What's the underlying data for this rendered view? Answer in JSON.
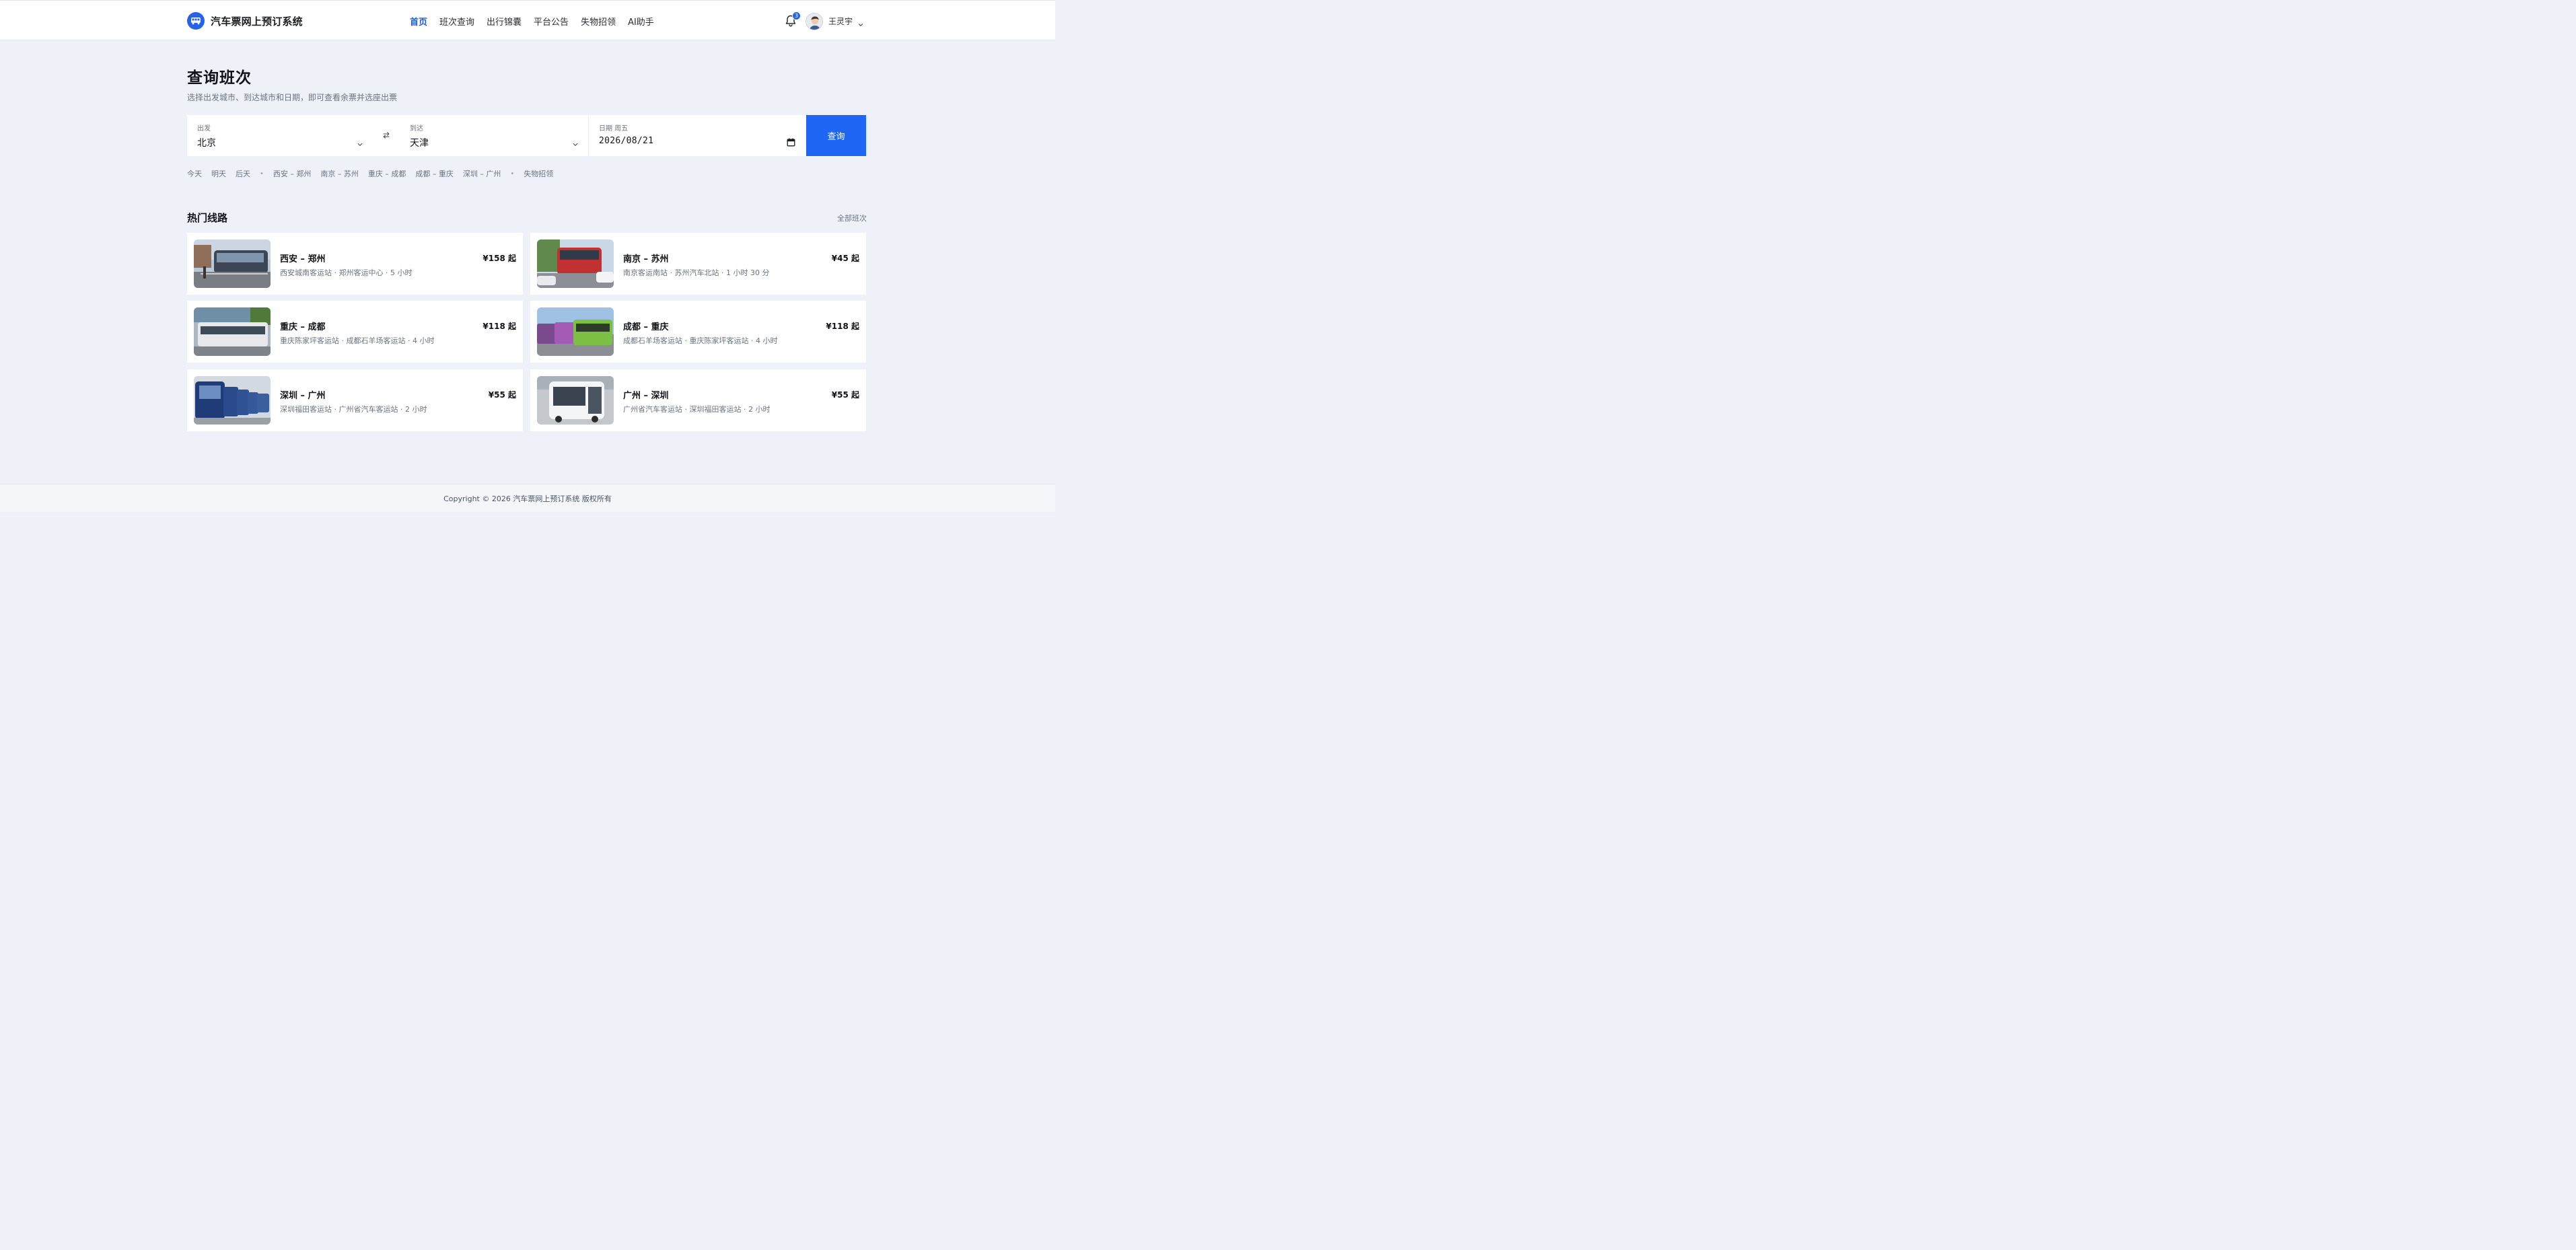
{
  "header": {
    "brand_title": "汽车票网上预订系统",
    "nav": [
      {
        "label": "首页",
        "active": true
      },
      {
        "label": "班次查询"
      },
      {
        "label": "出行锦囊"
      },
      {
        "label": "平台公告"
      },
      {
        "label": "失物招领"
      },
      {
        "label": "AI助手"
      }
    ],
    "notification_count": "3",
    "user_name": "王灵宇"
  },
  "page": {
    "title": "查询班次",
    "subtitle": "选择出发城市、到达城市和日期，即可查看余票并选座出票"
  },
  "search": {
    "from_label": "出发",
    "from_value": "北京",
    "to_label": "到达",
    "to_value": "天津",
    "date_label": "日期 周五",
    "date_value": "2026/08/21",
    "submit_label": "查询"
  },
  "quick_links": {
    "dates": [
      "今天",
      "明天",
      "后天"
    ],
    "routes": [
      "西安 – 郑州",
      "南京 – 苏州",
      "重庆 – 成都",
      "成都 – 重庆",
      "深圳 – 广州"
    ],
    "extra": [
      "失物招领"
    ]
  },
  "hot_routes": {
    "title": "热门线路",
    "all_link": "全部班次",
    "cards": [
      {
        "route": "西安 – 郑州",
        "meta": "西安城南客运站 · 郑州客运中心 · 5 小时",
        "price": "¥158 起"
      },
      {
        "route": "南京 – 苏州",
        "meta": "南京客运南站 · 苏州汽车北站 · 1 小时 30 分",
        "price": "¥45 起"
      },
      {
        "route": "重庆 – 成都",
        "meta": "重庆陈家坪客运站 · 成都石羊场客运站 · 4 小时",
        "price": "¥118 起"
      },
      {
        "route": "成都 – 重庆",
        "meta": "成都石羊场客运站 · 重庆陈家坪客运站 · 4 小时",
        "price": "¥118 起"
      },
      {
        "route": "深圳 – 广州",
        "meta": "深圳福田客运站 · 广州省汽车客运站 · 2 小时",
        "price": "¥55 起"
      },
      {
        "route": "广州 – 深圳",
        "meta": "广州省汽车客运站 · 深圳福田客运站 · 2 小时",
        "price": "¥55 起"
      }
    ]
  },
  "footer": {
    "copyright": "Copyright © 2026 汽车票网上预订系统 版权所有"
  },
  "colors": {
    "accent": "#1f66f5",
    "nav_active": "#1f5ad8",
    "page_bg": "#eef2f8"
  },
  "icons": [
    "bus-icon",
    "bell-icon",
    "chevron-down-icon",
    "swap-icon",
    "calendar-icon"
  ]
}
